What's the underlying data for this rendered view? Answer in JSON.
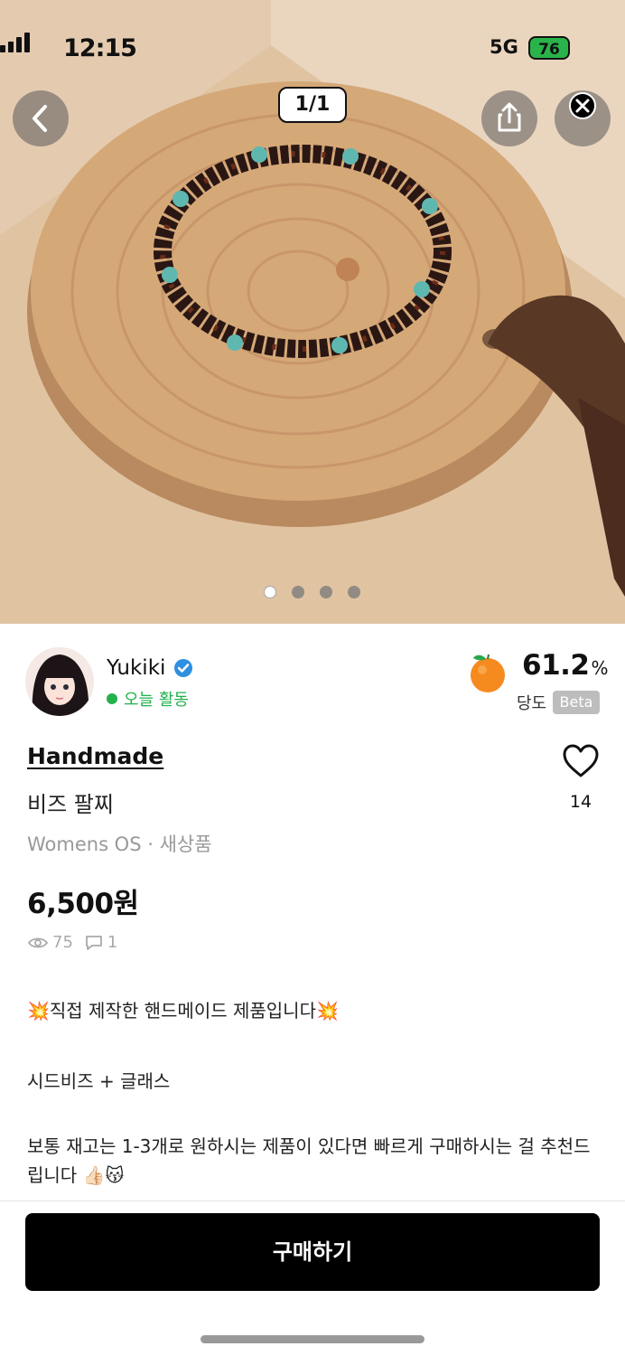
{
  "status_bar": {
    "time": "12:15",
    "network": "5G",
    "battery": "76"
  },
  "gallery": {
    "counter": "1/1",
    "page_count": 4,
    "active_page": 1
  },
  "seller": {
    "name": "Yukiki",
    "activity": "오늘 활동",
    "score": "61.2",
    "score_unit": "%",
    "score_label": "당도",
    "score_badge": "Beta"
  },
  "product": {
    "category": "Handmade",
    "title": "비즈 팔찌",
    "meta": "Womens OS · 새상품",
    "price": "6,500원",
    "like_count": "14",
    "views": "75",
    "comments": "1"
  },
  "description": {
    "line1": "💥직접 제작한 핸드메이드 제품입니다💥",
    "line2": "시드비즈 + 글래스",
    "line3": "보통 재고는 1-3개로 원하시는 제품이 있다면 빠르게 구매하시는 걸 추천드립니다 👍🏻😽"
  },
  "actions": {
    "buy_label": "구매하기"
  },
  "colors": {
    "accent_green": "#22b14c",
    "button_black": "#000000"
  }
}
